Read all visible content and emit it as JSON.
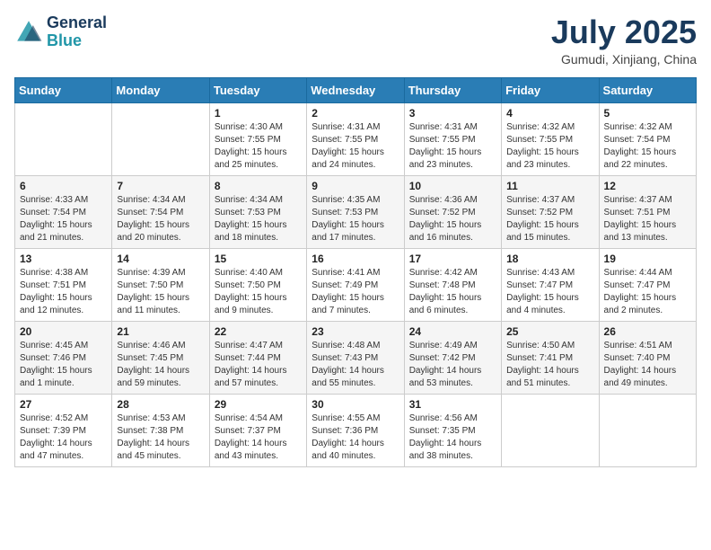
{
  "header": {
    "logo_line1": "General",
    "logo_line2": "Blue",
    "month_year": "July 2025",
    "location": "Gumudi, Xinjiang, China"
  },
  "days_of_week": [
    "Sunday",
    "Monday",
    "Tuesday",
    "Wednesday",
    "Thursday",
    "Friday",
    "Saturday"
  ],
  "weeks": [
    [
      {
        "day": "",
        "info": ""
      },
      {
        "day": "",
        "info": ""
      },
      {
        "day": "1",
        "info": "Sunrise: 4:30 AM\nSunset: 7:55 PM\nDaylight: 15 hours\nand 25 minutes."
      },
      {
        "day": "2",
        "info": "Sunrise: 4:31 AM\nSunset: 7:55 PM\nDaylight: 15 hours\nand 24 minutes."
      },
      {
        "day": "3",
        "info": "Sunrise: 4:31 AM\nSunset: 7:55 PM\nDaylight: 15 hours\nand 23 minutes."
      },
      {
        "day": "4",
        "info": "Sunrise: 4:32 AM\nSunset: 7:55 PM\nDaylight: 15 hours\nand 23 minutes."
      },
      {
        "day": "5",
        "info": "Sunrise: 4:32 AM\nSunset: 7:54 PM\nDaylight: 15 hours\nand 22 minutes."
      }
    ],
    [
      {
        "day": "6",
        "info": "Sunrise: 4:33 AM\nSunset: 7:54 PM\nDaylight: 15 hours\nand 21 minutes."
      },
      {
        "day": "7",
        "info": "Sunrise: 4:34 AM\nSunset: 7:54 PM\nDaylight: 15 hours\nand 20 minutes."
      },
      {
        "day": "8",
        "info": "Sunrise: 4:34 AM\nSunset: 7:53 PM\nDaylight: 15 hours\nand 18 minutes."
      },
      {
        "day": "9",
        "info": "Sunrise: 4:35 AM\nSunset: 7:53 PM\nDaylight: 15 hours\nand 17 minutes."
      },
      {
        "day": "10",
        "info": "Sunrise: 4:36 AM\nSunset: 7:52 PM\nDaylight: 15 hours\nand 16 minutes."
      },
      {
        "day": "11",
        "info": "Sunrise: 4:37 AM\nSunset: 7:52 PM\nDaylight: 15 hours\nand 15 minutes."
      },
      {
        "day": "12",
        "info": "Sunrise: 4:37 AM\nSunset: 7:51 PM\nDaylight: 15 hours\nand 13 minutes."
      }
    ],
    [
      {
        "day": "13",
        "info": "Sunrise: 4:38 AM\nSunset: 7:51 PM\nDaylight: 15 hours\nand 12 minutes."
      },
      {
        "day": "14",
        "info": "Sunrise: 4:39 AM\nSunset: 7:50 PM\nDaylight: 15 hours\nand 11 minutes."
      },
      {
        "day": "15",
        "info": "Sunrise: 4:40 AM\nSunset: 7:50 PM\nDaylight: 15 hours\nand 9 minutes."
      },
      {
        "day": "16",
        "info": "Sunrise: 4:41 AM\nSunset: 7:49 PM\nDaylight: 15 hours\nand 7 minutes."
      },
      {
        "day": "17",
        "info": "Sunrise: 4:42 AM\nSunset: 7:48 PM\nDaylight: 15 hours\nand 6 minutes."
      },
      {
        "day": "18",
        "info": "Sunrise: 4:43 AM\nSunset: 7:47 PM\nDaylight: 15 hours\nand 4 minutes."
      },
      {
        "day": "19",
        "info": "Sunrise: 4:44 AM\nSunset: 7:47 PM\nDaylight: 15 hours\nand 2 minutes."
      }
    ],
    [
      {
        "day": "20",
        "info": "Sunrise: 4:45 AM\nSunset: 7:46 PM\nDaylight: 15 hours\nand 1 minute."
      },
      {
        "day": "21",
        "info": "Sunrise: 4:46 AM\nSunset: 7:45 PM\nDaylight: 14 hours\nand 59 minutes."
      },
      {
        "day": "22",
        "info": "Sunrise: 4:47 AM\nSunset: 7:44 PM\nDaylight: 14 hours\nand 57 minutes."
      },
      {
        "day": "23",
        "info": "Sunrise: 4:48 AM\nSunset: 7:43 PM\nDaylight: 14 hours\nand 55 minutes."
      },
      {
        "day": "24",
        "info": "Sunrise: 4:49 AM\nSunset: 7:42 PM\nDaylight: 14 hours\nand 53 minutes."
      },
      {
        "day": "25",
        "info": "Sunrise: 4:50 AM\nSunset: 7:41 PM\nDaylight: 14 hours\nand 51 minutes."
      },
      {
        "day": "26",
        "info": "Sunrise: 4:51 AM\nSunset: 7:40 PM\nDaylight: 14 hours\nand 49 minutes."
      }
    ],
    [
      {
        "day": "27",
        "info": "Sunrise: 4:52 AM\nSunset: 7:39 PM\nDaylight: 14 hours\nand 47 minutes."
      },
      {
        "day": "28",
        "info": "Sunrise: 4:53 AM\nSunset: 7:38 PM\nDaylight: 14 hours\nand 45 minutes."
      },
      {
        "day": "29",
        "info": "Sunrise: 4:54 AM\nSunset: 7:37 PM\nDaylight: 14 hours\nand 43 minutes."
      },
      {
        "day": "30",
        "info": "Sunrise: 4:55 AM\nSunset: 7:36 PM\nDaylight: 14 hours\nand 40 minutes."
      },
      {
        "day": "31",
        "info": "Sunrise: 4:56 AM\nSunset: 7:35 PM\nDaylight: 14 hours\nand 38 minutes."
      },
      {
        "day": "",
        "info": ""
      },
      {
        "day": "",
        "info": ""
      }
    ]
  ]
}
